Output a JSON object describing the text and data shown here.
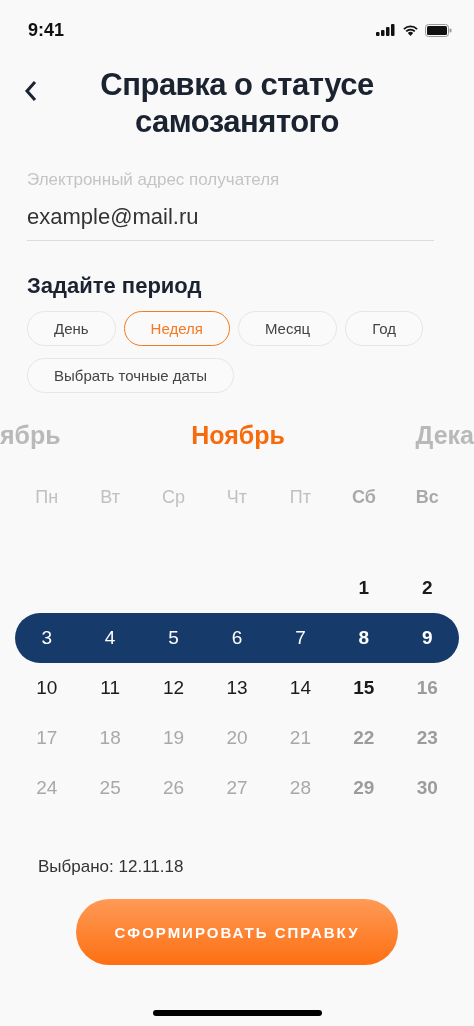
{
  "status_bar": {
    "time": "9:41"
  },
  "header": {
    "title": "Справка о статусе самозанятого"
  },
  "email": {
    "label": "Электронный адрес получателя",
    "value": "example@mail.ru"
  },
  "period": {
    "title": "Задайте период",
    "options": [
      {
        "label": "День",
        "selected": false
      },
      {
        "label": "Неделя",
        "selected": true
      },
      {
        "label": "Месяц",
        "selected": false
      },
      {
        "label": "Год",
        "selected": false
      },
      {
        "label": "Выбрать точные даты",
        "selected": false
      }
    ]
  },
  "months": [
    {
      "label": "ябрь",
      "selected": false
    },
    {
      "label": "Ноябрь",
      "selected": true
    },
    {
      "label": "Дека",
      "selected": false
    }
  ],
  "weekdays": [
    "Пн",
    "Вт",
    "Ср",
    "Чт",
    "Пт",
    "Сб",
    "Вс"
  ],
  "weeks": [
    {
      "kind": "partial",
      "selected": false,
      "days": [
        {
          "day": "1",
          "disabled": false
        },
        {
          "day": "2",
          "disabled": false
        }
      ]
    },
    {
      "kind": "full",
      "selected": true,
      "days": [
        {
          "day": "3",
          "disabled": false
        },
        {
          "day": "4",
          "disabled": false
        },
        {
          "day": "5",
          "disabled": false
        },
        {
          "day": "6",
          "disabled": false
        },
        {
          "day": "7",
          "disabled": false
        },
        {
          "day": "8",
          "disabled": false
        },
        {
          "day": "9",
          "disabled": false
        }
      ]
    },
    {
      "kind": "full",
      "selected": false,
      "days": [
        {
          "day": "10",
          "disabled": false
        },
        {
          "day": "11",
          "disabled": false
        },
        {
          "day": "12",
          "disabled": false
        },
        {
          "day": "13",
          "disabled": false
        },
        {
          "day": "14",
          "disabled": false
        },
        {
          "day": "15",
          "disabled": false
        },
        {
          "day": "16",
          "disabled": true
        }
      ]
    },
    {
      "kind": "full",
      "selected": false,
      "days": [
        {
          "day": "17",
          "disabled": true
        },
        {
          "day": "18",
          "disabled": true
        },
        {
          "day": "19",
          "disabled": true
        },
        {
          "day": "20",
          "disabled": true
        },
        {
          "day": "21",
          "disabled": true
        },
        {
          "day": "22",
          "disabled": true
        },
        {
          "day": "23",
          "disabled": true
        }
      ]
    },
    {
      "kind": "full",
      "selected": false,
      "days": [
        {
          "day": "24",
          "disabled": true
        },
        {
          "day": "25",
          "disabled": true
        },
        {
          "day": "26",
          "disabled": true
        },
        {
          "day": "27",
          "disabled": true
        },
        {
          "day": "28",
          "disabled": true
        },
        {
          "day": "29",
          "disabled": true
        },
        {
          "day": "30",
          "disabled": true
        }
      ]
    }
  ],
  "selected_text": "Выбрано: 12.11.18",
  "submit": "СФОРМИРОВАТЬ СПРАВКУ"
}
